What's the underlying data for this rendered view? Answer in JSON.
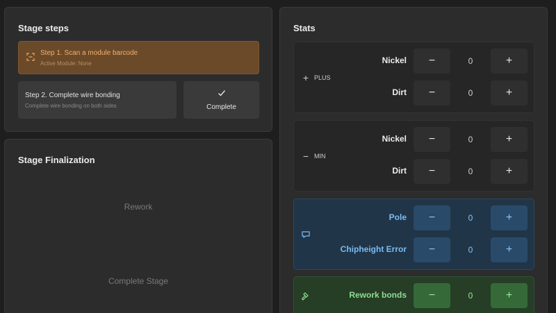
{
  "stage_steps": {
    "title": "Stage steps",
    "step1": {
      "title": "Step 1. Scan a module barcode",
      "subtitle": "Active Module: None"
    },
    "step2": {
      "title": "Step 2. Complete wire bonding",
      "subtitle": "Complete wire bonding on both sides"
    },
    "complete_label": "Complete"
  },
  "stage_finalization": {
    "title": "Stage Finalization",
    "rework_label": "Rework",
    "complete_stage_label": "Complete Stage"
  },
  "stats": {
    "title": "Stats",
    "plus_group": {
      "label": "PLUS",
      "rows": [
        {
          "name": "Nickel",
          "value": "0"
        },
        {
          "name": "Dirt",
          "value": "0"
        }
      ]
    },
    "min_group": {
      "label": "MIN",
      "rows": [
        {
          "name": "Nickel",
          "value": "0"
        },
        {
          "name": "Dirt",
          "value": "0"
        }
      ]
    },
    "pole_group": {
      "icon": "flag-icon",
      "rows": [
        {
          "name": "Pole",
          "value": "0"
        },
        {
          "name": "Chipheight Error",
          "value": "0"
        }
      ]
    },
    "rework_group": {
      "icon": "hammer-icon",
      "rows": [
        {
          "name": "Rework bonds",
          "value": "0"
        }
      ]
    },
    "minus_symbol": "−",
    "plus_symbol": "+"
  },
  "colors": {
    "active_step_bg": "#6b4a2a",
    "active_step_text": "#f3b071",
    "blue_group_bg": "#213548",
    "blue_accent": "#7bbcf2",
    "green_group_bg": "#263d26",
    "green_accent": "#8fdc8f"
  }
}
